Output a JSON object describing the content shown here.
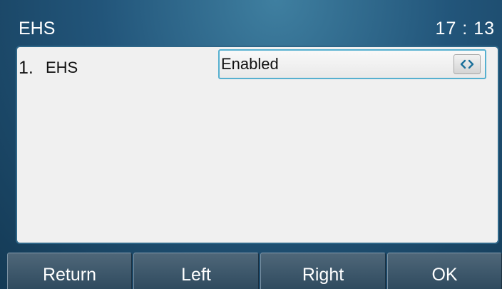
{
  "header": {
    "title": "EHS",
    "time": "17 : 13"
  },
  "settings": [
    {
      "index": "1.",
      "label": "EHS",
      "value": "Enabled",
      "switch_icon": "left-right-arrows-icon"
    }
  ],
  "softkeys": {
    "return_label": "Return",
    "left_label": "Left",
    "right_label": "Right",
    "ok_label": "OK"
  },
  "colors": {
    "accent_border": "#56b0d0",
    "switch_arrows": "#1a6f9a",
    "panel_bg": "#f0f0f0"
  }
}
